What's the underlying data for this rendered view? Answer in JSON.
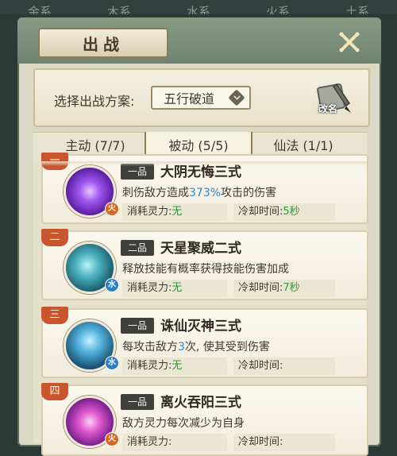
{
  "element_tabs": [
    "金系",
    "木系",
    "水系",
    "火系",
    "土系"
  ],
  "title": "出战",
  "plan": {
    "label": "选择出战方案:",
    "selected": "五行破道",
    "rename_label": "改名"
  },
  "tabs": [
    {
      "label": "主动 (7/7)"
    },
    {
      "label": "被动 (5/5)"
    },
    {
      "label": "仙法 (1/1)"
    }
  ],
  "skills": [
    {
      "index": "一",
      "grade": "一品",
      "name": "大阴无悔三式",
      "desc_prefix": "刺伤敌方造成",
      "desc_highlight": "373%",
      "desc_suffix": "攻击的伤害",
      "cost_label": "消耗灵力:",
      "cost_value": "无",
      "cooldown_label": "冷却时间:",
      "cooldown_value": "5秒",
      "element": "火",
      "element_color": "#d9661f",
      "icon_color": "#8a3bd6"
    },
    {
      "index": "二",
      "grade": "二品",
      "name": "天星聚威二式",
      "desc_prefix": "释放技能有概率获得技能伤害加成",
      "desc_highlight": "",
      "desc_suffix": "",
      "cost_label": "消耗灵力:",
      "cost_value": "无",
      "cooldown_label": "冷却时间:",
      "cooldown_value": "7秒",
      "element": "水",
      "element_color": "#2c7dc6",
      "icon_color": "#2a8a98"
    },
    {
      "index": "三",
      "grade": "一品",
      "name": "诛仙灭神三式",
      "desc_prefix": "每攻击敌方",
      "desc_highlight": "3",
      "desc_suffix": "次, 使其受到伤害",
      "cost_label": "消耗灵力:",
      "cost_value": "无",
      "cooldown_label": "冷却时间:",
      "cooldown_value": "",
      "element": "水",
      "element_color": "#2c7dc6",
      "icon_color": "#1f6e96"
    },
    {
      "index": "四",
      "grade": "一品",
      "name": "离火吞阳三式",
      "desc_prefix": "敌方灵力每次减少为自身",
      "desc_highlight": "",
      "desc_suffix": "",
      "cost_label": "消耗灵力:",
      "cost_value": "",
      "cooldown_label": "冷却时间:",
      "cooldown_value": "",
      "element": "火",
      "element_color": "#d9661f",
      "icon_color": "#a0399f"
    }
  ]
}
